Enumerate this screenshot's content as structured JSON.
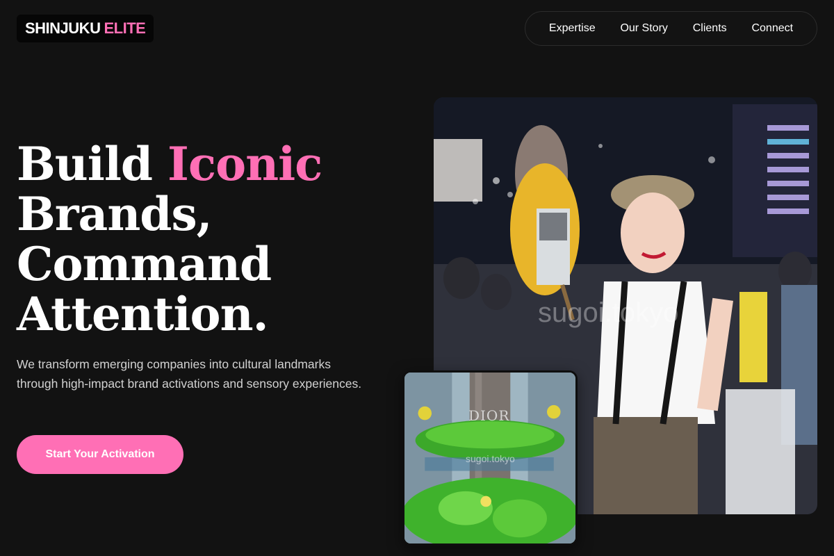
{
  "header": {
    "logo_main": "SHINJUKU",
    "logo_accent": "ELITE",
    "nav": [
      "Expertise",
      "Our Story",
      "Clients",
      "Connect"
    ]
  },
  "hero": {
    "headline_1": "Build",
    "headline_accent": "Iconic",
    "headline_2": "Brands,",
    "headline_3": "Command",
    "headline_4": "Attention.",
    "subtext": "We transform emerging companies into cultural landmarks through high-impact brand activations and sensory experiences.",
    "cta_label": "Start Your Activation"
  },
  "images": {
    "main_watermark": "sugoi.tokyo",
    "inset_watermark": "sugoi.tokyo",
    "inset_sign": "DIOR"
  },
  "colors": {
    "background": "#121212",
    "accent": "#ff6fb5",
    "text": "#ffffff",
    "muted_text": "#d2d2d2"
  }
}
